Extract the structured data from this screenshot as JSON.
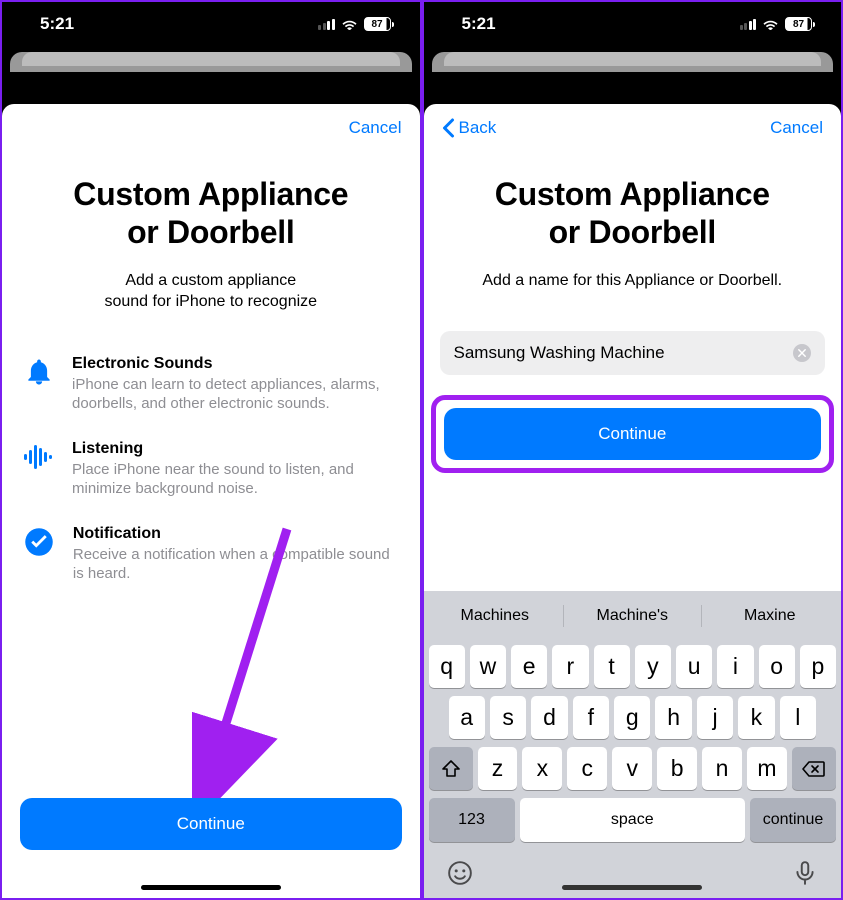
{
  "status": {
    "time": "5:21",
    "battery": "87"
  },
  "left": {
    "nav": {
      "cancel": "Cancel"
    },
    "title_line1": "Custom Appliance",
    "title_line2": "or Doorbell",
    "subtitle_line1": "Add a custom appliance",
    "subtitle_line2": "sound for iPhone to recognize",
    "features": [
      {
        "title": "Electronic Sounds",
        "desc": "iPhone can learn to detect appliances, alarms, doorbells, and other electronic sounds."
      },
      {
        "title": "Listening",
        "desc": "Place iPhone near the sound to listen, and minimize background noise."
      },
      {
        "title": "Notification",
        "desc": "Receive a notification when a compatible sound is heard."
      }
    ],
    "continue": "Continue"
  },
  "right": {
    "nav": {
      "back": "Back",
      "cancel": "Cancel"
    },
    "title_line1": "Custom Appliance",
    "title_line2": "or Doorbell",
    "subtitle": "Add a name for this Appliance or Doorbell.",
    "input_value": "Samsung Washing Machine",
    "continue": "Continue",
    "keyboard": {
      "suggestions": [
        "Machines",
        "Machine's",
        "Maxine"
      ],
      "row1": [
        "q",
        "w",
        "e",
        "r",
        "t",
        "y",
        "u",
        "i",
        "o",
        "p"
      ],
      "row2": [
        "a",
        "s",
        "d",
        "f",
        "g",
        "h",
        "j",
        "k",
        "l"
      ],
      "row3": [
        "z",
        "x",
        "c",
        "v",
        "b",
        "n",
        "m"
      ],
      "numkey": "123",
      "space": "space",
      "return": "continue"
    }
  }
}
